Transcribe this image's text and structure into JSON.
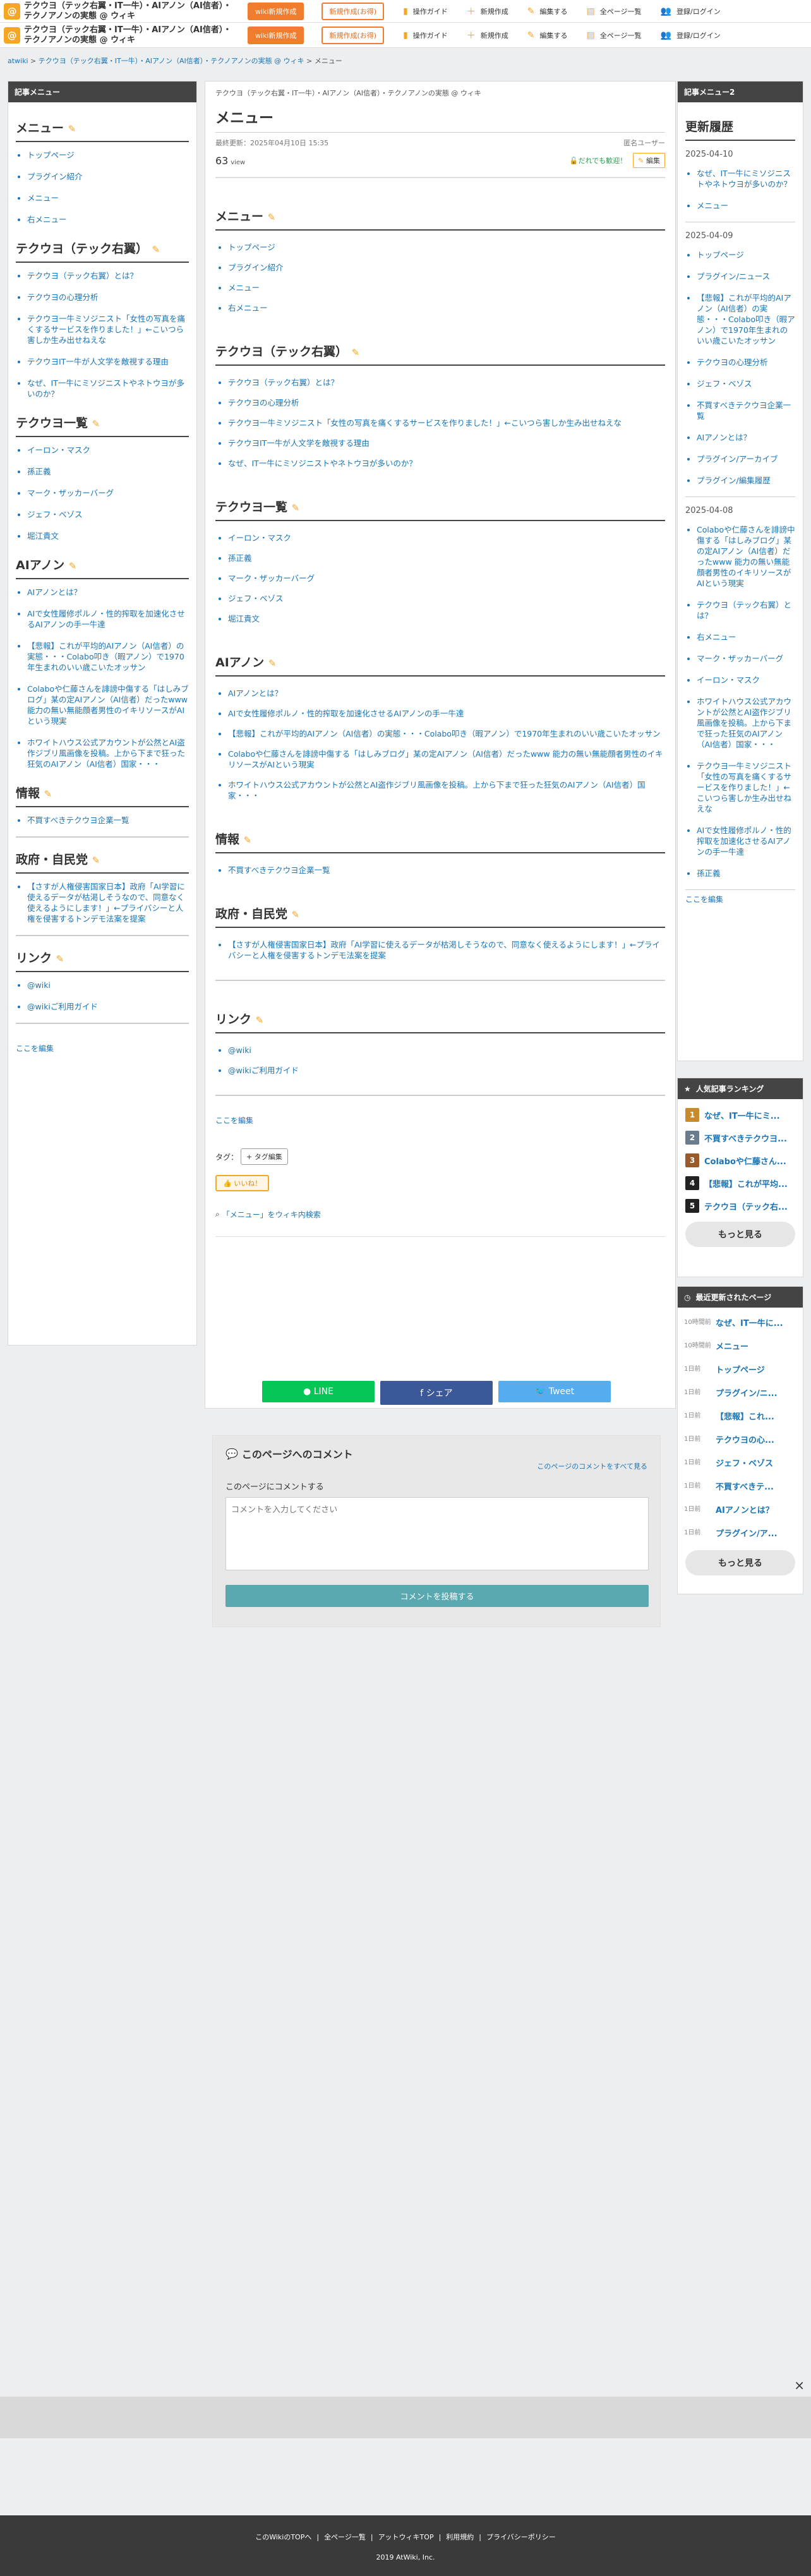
{
  "site": {
    "title": "テクウヨ（テック右翼・IT一牛）・AIアノン（AI信者）・テクノアノンの実態 @ ウィキ",
    "logo": "@",
    "edit_btn": "wiki新規作成",
    "reg_btn": "新規作成(お得)"
  },
  "topnav": [
    {
      "icon": "guide-icon",
      "label": "操作ガイド"
    },
    {
      "icon": "plus-icon",
      "label": "新規作成"
    },
    {
      "icon": "edit-icon",
      "label": "編集する"
    },
    {
      "icon": "pages-icon",
      "label": "全ページ一覧"
    },
    {
      "icon": "user-icon",
      "label": "登録/ログイン"
    }
  ],
  "breadcrumb": {
    "a": "atwiki",
    "b": "テクウヨ（テック右翼・IT一牛）・AIアノン（AI信者）・テクノアノンの実態 @ ウィキ",
    "c": "メニュー"
  },
  "left": {
    "title": "記事メニュー",
    "sections": [
      {
        "h": "メニュー",
        "items": [
          "トップページ",
          "プラグイン紹介",
          "メニュー",
          "右メニュー"
        ]
      },
      {
        "h": "テクウヨ（テック右翼）",
        "items": [
          "テクウヨ（テック右翼）とは？",
          "テクウヨの心理分析",
          "テクウヨ一牛ミソジニスト「女性の写真を痛くするサービスを作りました！」←こいつら害しか生み出せねえな",
          "テクウヨIT一牛が人文学を敵視する理由",
          "なぜ、IT一牛にミソジニストやネトウヨが多いのか？"
        ]
      },
      {
        "h": "テクウヨ一覧",
        "items": [
          "イーロン・マスク",
          "孫正義",
          "マーク・ザッカーバーグ",
          "ジェフ・ベゾス",
          "堀江貴文"
        ]
      },
      {
        "h": "AIアノン",
        "items": [
          "AIアノンとは？",
          "AIで女性履修ポルノ・性的搾取を加速化させるAIアノンの手一牛達",
          "【悲報】これが平均的AIアノン（AI信者）の実態・・・Colabo叩き（暇アノン）で1970年生まれのいい歳こいたオッサン",
          "Colaboや仁藤さんを誹謗中傷する「はしみブログ」某の定AIアノン（AI信者）だったwww 能力の無い無能顔者男性のイキリソースがAIという現実",
          "ホワイトハウス公式アカウントが公然とAI盗作ジブリ風画像を投稿。上から下まで狂った狂気のAIアノン（AI信者）国家・・・"
        ]
      },
      {
        "h": "情報",
        "items": [
          "不買すべきテクウヨ企業一覧"
        ]
      },
      {
        "h": "政府・自民党",
        "items": [
          "【さすが人権侵害国家日本】政府「AI学習に使えるデータが枯渇しそうなので、同意なく使えるようにします！」←プライバシーと人権を侵害するトンデモ法案を提案"
        ]
      },
      {
        "h": "リンク",
        "items": [
          "@wiki",
          "@wikiご利用ガイド"
        ]
      }
    ],
    "edit": "ここを編集"
  },
  "main": {
    "crumb": "テクウヨ（テック右翼・IT一牛）・AIアノン（AI信者）・テクノアノンの実態 @ ウィキ",
    "title": "メニュー",
    "updated": "最終更新：2025年04月10日 15:35",
    "author": "匿名ユーザー",
    "views": "63",
    "views_unit": "view",
    "badge": "だれでも歓迎！",
    "edit_btn": "編集",
    "sections": [
      {
        "h": "メニュー",
        "items": [
          "トップページ",
          "プラグイン紹介",
          "メニュー",
          "右メニュー"
        ]
      },
      {
        "h": "テクウヨ（テック右翼）",
        "items": [
          "テクウヨ（テック右翼）とは？",
          "テクウヨの心理分析",
          "テクウヨ一牛ミソジニスト「女性の写真を痛くするサービスを作りました！」←こいつら害しか生み出せねえな",
          "テクウヨIT一牛が人文学を敵視する理由",
          "なぜ、IT一牛にミソジニストやネトウヨが多いのか？"
        ]
      },
      {
        "h": "テクウヨ一覧",
        "items": [
          "イーロン・マスク",
          "孫正義",
          "マーク・ザッカーバーグ",
          "ジェフ・ベゾス",
          "堀江貴文"
        ]
      },
      {
        "h": "AIアノン",
        "items": [
          "AIアノンとは？",
          "AIで女性履修ポルノ・性的搾取を加速化させるAIアノンの手一牛達",
          "【悲報】これが平均的AIアノン（AI信者）の実態・・・Colabo叩き（暇アノン）で1970年生まれのいい歳こいたオッサン",
          "Colaboや仁藤さんを誹謗中傷する「はしみブログ」某の定AIアノン（AI信者）だったwww 能力の無い無能顔者男性のイキリソースがAIという現実",
          "ホワイトハウス公式アカウントが公然とAI盗作ジブリ風画像を投稿。上から下まで狂った狂気のAIアノン（AI信者）国家・・・"
        ]
      },
      {
        "h": "情報",
        "items": [
          "不買すべきテクウヨ企業一覧"
        ]
      },
      {
        "h": "政府・自民党",
        "items": [
          "【さすが人権侵害国家日本】政府「AI学習に使えるデータが枯渇しそうなので、同意なく使えるようにします！」←プライバシーと人権を侵害するトンデモ法案を提案"
        ]
      },
      {
        "h": "リンク",
        "items": [
          "@wiki",
          "@wikiご利用ガイド"
        ]
      }
    ],
    "edit": "ここを編集",
    "tag_label": "タグ：",
    "tag_btn": "+ タグ編集",
    "like": "いいね！",
    "search": "「メニュー」をウィキ内検索",
    "share": [
      {
        "label": "LINE",
        "color": "#06c755"
      },
      {
        "label": "シェア",
        "color": "#3b5998"
      },
      {
        "label": "Tweet",
        "color": "#55acee"
      }
    ]
  },
  "comment": {
    "title": "このページへのコメント",
    "all": "このページのコメントをすべて見る",
    "label": "このページにコメントする",
    "placeholder": "コメントを入力してください",
    "submit": "コメントを投稿する"
  },
  "right": {
    "title": "記事メニュー2",
    "h": "更新履歴",
    "groups": [
      {
        "date": "2025-04-10",
        "items": [
          "なぜ、IT一牛にミソジニストやネトウヨが多いのか？",
          "メニュー"
        ]
      },
      {
        "date": "2025-04-09",
        "items": [
          "トップページ",
          "プラグイン/ニュース",
          "【悲報】これが平均的AIアノン（AI信者）の実態・・・Colabo叩き（暇アノン）で1970年生まれのいい歳こいたオッサン",
          "テクウヨの心理分析",
          "ジェフ・ベゾス",
          "不買すべきテクウヨ企業一覧",
          "AIアノンとは？",
          "プラグイン/アーカイブ",
          "プラグイン/編集履歴"
        ]
      },
      {
        "date": "2025-04-08",
        "items": [
          "Colaboや仁藤さんを誹謗中傷する「はしみブログ」某の定AIアノン（AI信者）だったwww 能力の無い無能顔者男性のイキリソースがAIという現実",
          "テクウヨ（テック右翼）とは？",
          "右メニュー",
          "マーク・ザッカーバーグ",
          "イーロン・マスク",
          "ホワイトハウス公式アカウントが公然とAI盗作ジブリ風画像を投稿。上から下まで狂った狂気のAIアノン（AI信者）国家・・・",
          "テクウヨ一牛ミソジニスト「女性の写真を痛くするサービスを作りました！」←こいつら害しか生み出せねえな",
          "AIで女性履修ポルノ・性的搾取を加速化させるAIアノンの手一牛達",
          "孫正義"
        ]
      }
    ],
    "edit": "ここを編集",
    "rank_title": "人気記事ランキング",
    "rank": [
      {
        "n": "1",
        "t": "なぜ、IT一牛にミ...",
        "c": "#c88a2a"
      },
      {
        "n": "2",
        "t": "不買すべきテクウヨ...",
        "c": "#6a7d8c"
      },
      {
        "n": "3",
        "t": "Colaboや仁藤さん...",
        "c": "#9a5a2a"
      },
      {
        "n": "4",
        "t": "【悲報】これが平均...",
        "c": "#222"
      },
      {
        "n": "5",
        "t": "テクウヨ（テック右...",
        "c": "#222"
      }
    ],
    "more": "もっと見る",
    "recent_title": "最近更新されたページ",
    "recent": [
      {
        "t": "10時間前",
        "p": "なぜ、IT一牛に..."
      },
      {
        "t": "10時間前",
        "p": "メニュー"
      },
      {
        "t": "1日前",
        "p": "トップページ"
      },
      {
        "t": "1日前",
        "p": "プラグイン/ニ..."
      },
      {
        "t": "1日前",
        "p": "【悲報】これ..."
      },
      {
        "t": "1日前",
        "p": "テクウヨの心..."
      },
      {
        "t": "1日前",
        "p": "ジェフ・ベゾス"
      },
      {
        "t": "1日前",
        "p": "不買すべきテ..."
      },
      {
        "t": "1日前",
        "p": "AIアノンとは？"
      },
      {
        "t": "1日前",
        "p": "プラグイン/ア..."
      }
    ]
  },
  "footer": {
    "links": [
      "このWikiのTOPへ",
      "全ページ一覧",
      "アットウィキTOP",
      "利用規約",
      "プライバシーポリシー"
    ],
    "copy": "2019 AtWiki, Inc."
  },
  "close": "×"
}
